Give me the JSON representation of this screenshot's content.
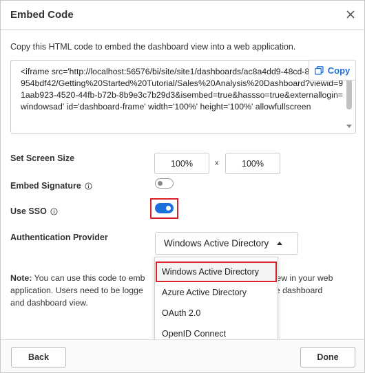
{
  "dialog": {
    "title": "Embed Code",
    "description": "Copy this HTML code to embed the dashboard view into a web application.",
    "code": "<iframe src='http://localhost:56576/bi/site/site1/dashboards/ac8a4dd9-48cd-83d9-347b954bdf42/Getting%20Started%20Tutorial/Sales%20Analysis%20Dashboard?viewid=91aab923-4520-44fb-b72b-8b9e3c7b29d3&isembed=true&hassso=true&externallogin=windowsad' id='dashboard-frame' width='100%' height='100%' allowfullscreen",
    "copy_label": "Copy"
  },
  "screen_size": {
    "label": "Set Screen Size",
    "width": "100%",
    "separator": "x",
    "height": "100%"
  },
  "embed_signature": {
    "label": "Embed Signature",
    "enabled": false
  },
  "use_sso": {
    "label": "Use SSO",
    "enabled": true
  },
  "auth_provider": {
    "label": "Authentication Provider",
    "selected": "Windows Active Directory",
    "options": [
      "Windows Active Directory",
      "Azure Active Directory",
      "OAuth 2.0",
      "OpenID Connect"
    ]
  },
  "note": {
    "prefix": "Note:",
    "line1": "You can use this code to emb",
    "line1b": "view in your web",
    "line2": "application. Users need to be logge",
    "line2b": "iew the dashboard",
    "line3": "and dashboard view."
  },
  "footer": {
    "back_label": "Back",
    "done_label": "Done"
  },
  "colors": {
    "accent": "#1d6fdc",
    "highlight": "#d9232a"
  }
}
